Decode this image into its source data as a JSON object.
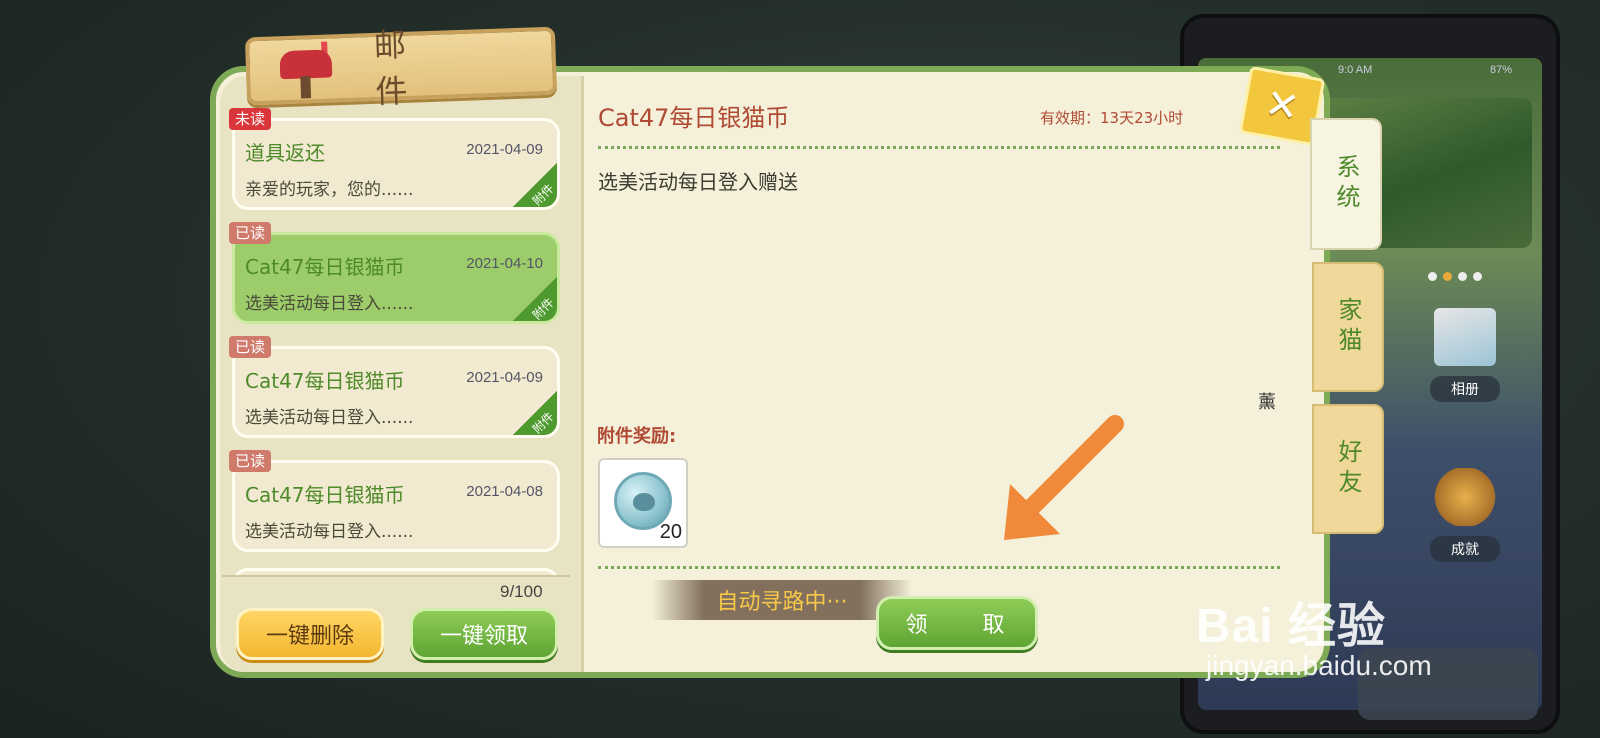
{
  "phone": {
    "time": "9:0 AM",
    "battery": "87%",
    "tiles": [
      {
        "label": "相册"
      },
      {
        "label": "成就"
      }
    ]
  },
  "mail": {
    "title": "邮 件",
    "count": "9/100",
    "items": [
      {
        "status": "未读",
        "subject": "道具返还",
        "date": "2021-04-09",
        "preview": "亲爱的玩家，您的......",
        "attachment": "附件",
        "selected": false
      },
      {
        "status": "已读",
        "subject": "Cat47每日银猫币",
        "date": "2021-04-10",
        "preview": "选美活动每日登入......",
        "attachment": "附件",
        "selected": true
      },
      {
        "status": "已读",
        "subject": "Cat47每日银猫币",
        "date": "2021-04-09",
        "preview": "选美活动每日登入......",
        "attachment": "附件",
        "selected": false
      },
      {
        "status": "已读",
        "subject": "Cat47每日银猫币",
        "date": "2021-04-08",
        "preview": "选美活动每日登入......",
        "attachment": "",
        "selected": false
      }
    ],
    "delete_all": "一键删除",
    "claim_all": "一键领取"
  },
  "detail": {
    "title": "Cat47每日银猫币",
    "validity": "有效期：13天23小时",
    "body": "选美活动每日登入赠送",
    "signature": "薰",
    "reward_label": "附件奖励:",
    "reward_qty": "20",
    "claim": "领 取",
    "auto_path": "自动寻路中···"
  },
  "tabs": [
    {
      "label": "系统",
      "active": true
    },
    {
      "label": "家猫",
      "active": false
    },
    {
      "label": "好友",
      "active": false
    }
  ],
  "close_label": "✕",
  "watermark": {
    "main": "Bai 经验",
    "sub": "jingyan.baidu.com"
  },
  "colors": {
    "accent_green": "#7faa55",
    "title_red": "#b04a34",
    "arrow": "#f08a3a"
  }
}
